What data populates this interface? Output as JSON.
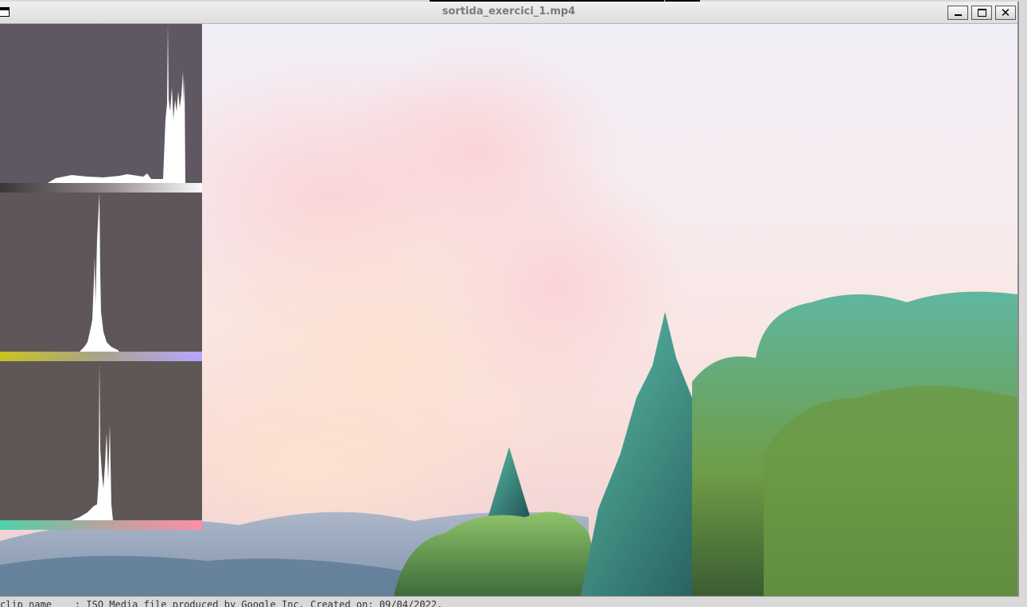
{
  "window": {
    "title": "sortida_exercici_1.mp4",
    "buttons": {
      "minimize": "minimize",
      "maximize": "maximize",
      "close": "✕"
    }
  },
  "histograms": [
    {
      "channel": "luminance",
      "bar_colors": [
        "#3a3638",
        "#fbfbfb"
      ]
    },
    {
      "channel": "chroma-u",
      "bar_colors": [
        "#c9c321",
        "#b7a6ff"
      ]
    },
    {
      "channel": "chroma-v",
      "bar_colors": [
        "#4fd1a8",
        "#ff8ea8"
      ]
    }
  ],
  "status": {
    "text": "clip name    : ISO Media file produced by Google Inc. Created on: 09/04/2022."
  },
  "icons": {
    "sysmenu": "window-menu-icon",
    "minimize": "minimize-icon",
    "maximize": "maximize-icon",
    "close": "close-icon"
  }
}
